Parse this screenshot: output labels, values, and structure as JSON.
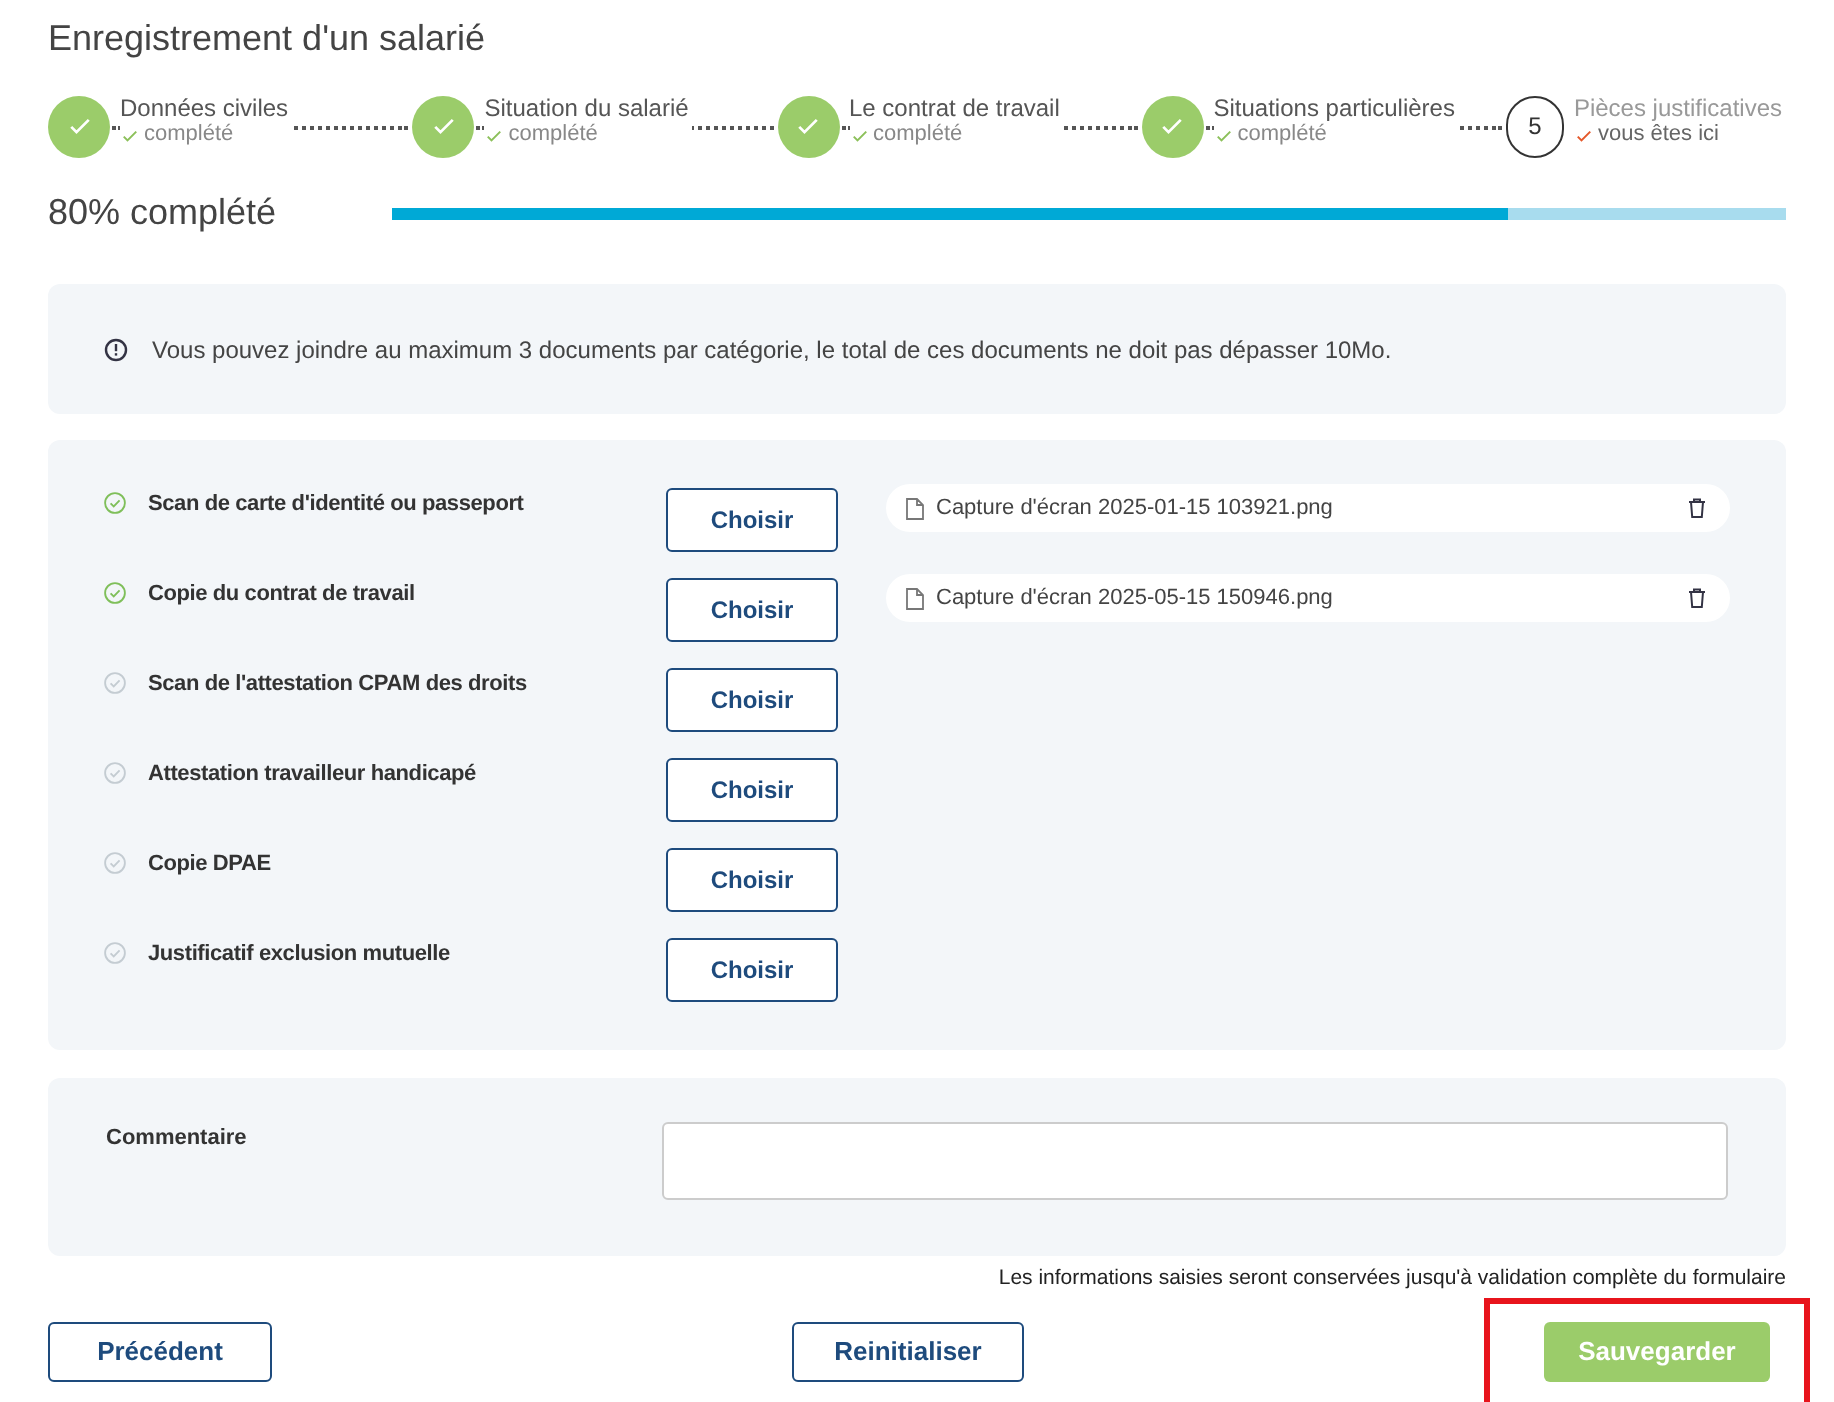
{
  "title": "Enregistrement d'un salarié",
  "steps": [
    {
      "label": "Données civiles",
      "status": "complété",
      "done": true
    },
    {
      "label": "Situation du salarié",
      "status": "complété",
      "done": true
    },
    {
      "label": "Le contrat de travail",
      "status": "complété",
      "done": true
    },
    {
      "label": "Situations particulières",
      "status": "complété",
      "done": true
    },
    {
      "label": "Pièces justificatives",
      "status": "vous êtes ici",
      "done": false,
      "number": "5"
    }
  ],
  "progress": {
    "label": "80% complété",
    "level": 0.8
  },
  "info": "Vous pouvez joindre au maximum 3 documents par catégorie, le total de ces documents ne doit pas dépasser 10Mo.",
  "documents": [
    {
      "label": "Scan de carte d'identité ou passeport",
      "checked": true,
      "button": "Choisir",
      "files": [
        "Capture d'écran 2025-01-15 103921.png"
      ]
    },
    {
      "label": "Copie du contrat de travail",
      "checked": true,
      "button": "Choisir",
      "files": [
        "Capture d'écran 2025-05-15 150946.png"
      ]
    },
    {
      "label": "Scan de l'attestation CPAM des droits",
      "checked": false,
      "button": "Choisir"
    },
    {
      "label": "Attestation travailleur handicapé",
      "checked": false,
      "button": "Choisir"
    },
    {
      "label": "Copie DPAE",
      "checked": false,
      "button": "Choisir"
    },
    {
      "label": "Justificatif exclusion mutuelle",
      "checked": false,
      "button": "Choisir"
    }
  ],
  "comment": {
    "label": "Commentaire"
  },
  "note": "Les informations saisies seront conservées jusqu'à validation complète du formulaire",
  "buttons": [
    {
      "label": "Précédent",
      "kind": "outline",
      "highlighted": false
    },
    {
      "label": "Reinitialiser",
      "kind": "outline",
      "highlighted": false
    },
    {
      "label": "Sauvegarder",
      "kind": "primary",
      "highlighted": true
    }
  ]
}
